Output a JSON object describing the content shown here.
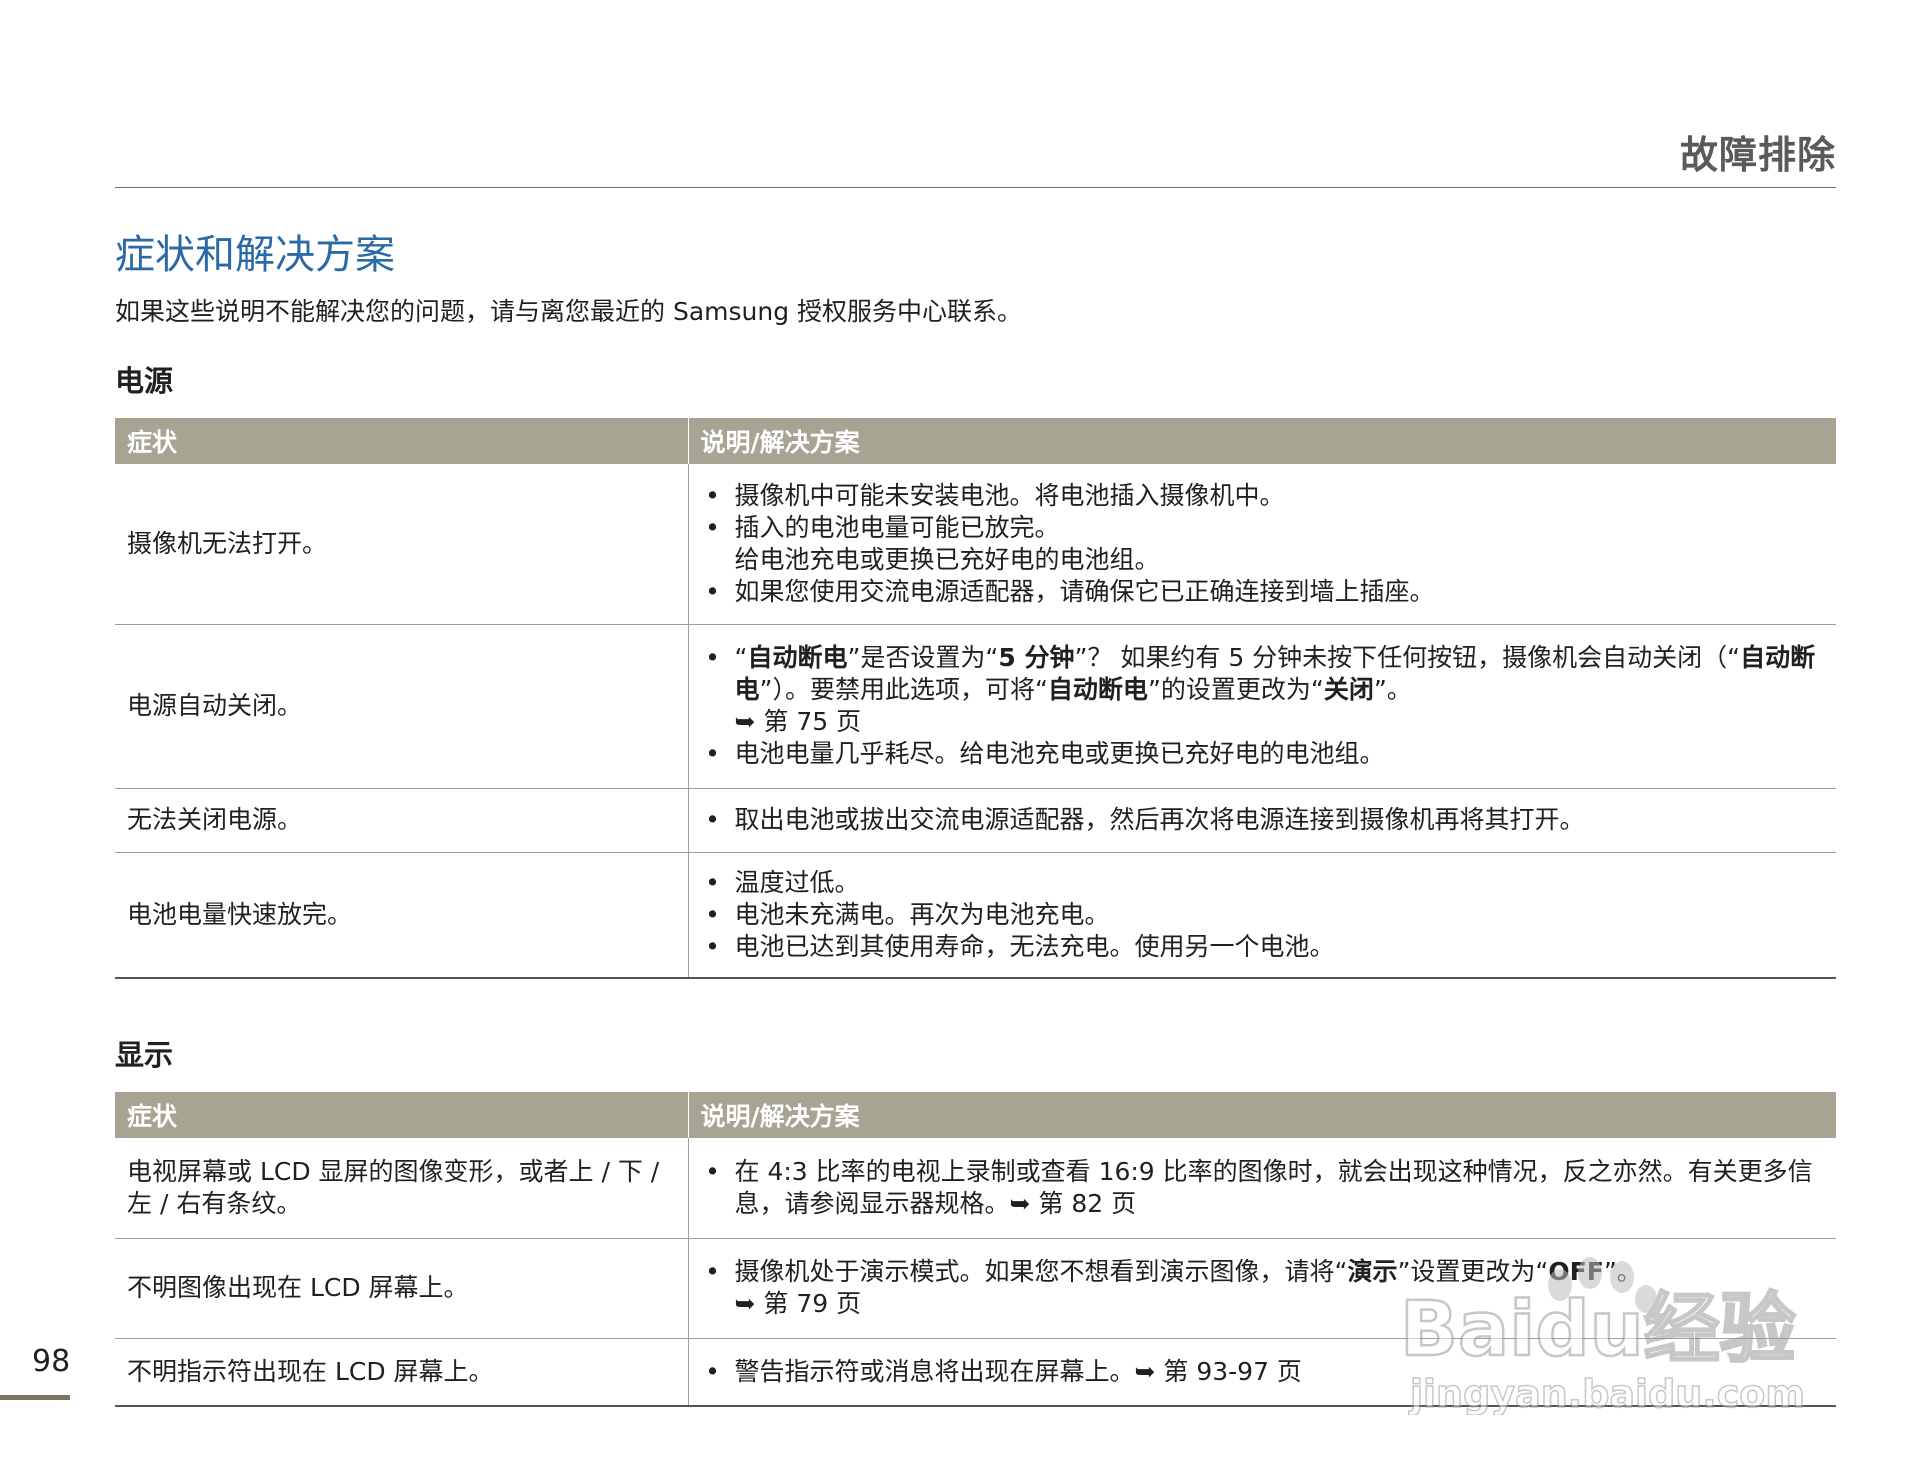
{
  "header": {
    "title": "故障排除"
  },
  "section": {
    "title": "症状和解决方案",
    "intro": "如果这些说明不能解决您的问题，请与离您最近的 Samsung 授权服务中心联系。"
  },
  "power": {
    "heading": "电源",
    "col_symptom": "症状",
    "col_solution": "说明/解决方案",
    "rows": [
      {
        "symptom": "摄像机无法打开。",
        "items": [
          {
            "text": "摄像机中可能未安装电池。将电池插入摄像机中。"
          },
          {
            "text": "插入的电池电量可能已放完。",
            "text2": "给电池充电或更换已充好电的电池组。"
          },
          {
            "text": "如果您使用交流电源适配器，请确保它已正确连接到墙上插座。"
          }
        ]
      },
      {
        "symptom": "电源自动关闭。",
        "items": [
          {
            "p1": "“",
            "b1": "自动断电",
            "p2": "”是否设置为“",
            "b2": "5 分钟",
            "p3": "”？ 如果约有 5 分钟未按下任何按钮，摄像机会自动关闭（“",
            "b3": "自动断电",
            "p4": "”）。要禁用此选项，可将“",
            "b4": "自动断电",
            "p5": "”的设置更改为“",
            "b5": "关闭",
            "p6": "”。",
            "ref": "➥ 第 75 页"
          },
          {
            "text": "电池电量几乎耗尽。给电池充电或更换已充好电的电池组。"
          }
        ]
      },
      {
        "symptom": "无法关闭电源。",
        "items": [
          {
            "text": "取出电池或拔出交流电源适配器，然后再次将电源连接到摄像机再将其打开。"
          }
        ]
      },
      {
        "symptom": "电池电量快速放完。",
        "items": [
          {
            "text": "温度过低。"
          },
          {
            "text": "电池未充满电。再次为电池充电。"
          },
          {
            "text": "电池已达到其使用寿命，无法充电。使用另一个电池。"
          }
        ]
      }
    ]
  },
  "display": {
    "heading": "显示",
    "col_symptom": "症状",
    "col_solution": "说明/解决方案",
    "rows": [
      {
        "symptom": "电视屏幕或 LCD 显屏的图像变形，或者上 / 下 / 左 / 右有条纹。",
        "items": [
          {
            "text": "在 4:3 比率的电视上录制或查看 16:9 比率的图像时，就会出现这种情况，反之亦然。有关更多信息，请参阅显示器规格。➥ 第 82 页"
          }
        ]
      },
      {
        "symptom": "不明图像出现在 LCD 屏幕上。",
        "items": [
          {
            "p1": "摄像机处于演示模式。如果您不想看到演示图像，请将“",
            "b1": "演示",
            "p2": "”设置更改为“",
            "b2": "OFF",
            "p3": "”。",
            "ref": "➥ 第 79 页"
          }
        ]
      },
      {
        "symptom": "不明指示符出现在 LCD 屏幕上。",
        "items": [
          {
            "text": "警告指示符或消息将出现在屏幕上。➥ 第 93-97 页"
          }
        ]
      }
    ]
  },
  "page_number": "98",
  "watermark": {
    "line1": "Baidu经验",
    "line2": "jingyan.baidu.com"
  }
}
